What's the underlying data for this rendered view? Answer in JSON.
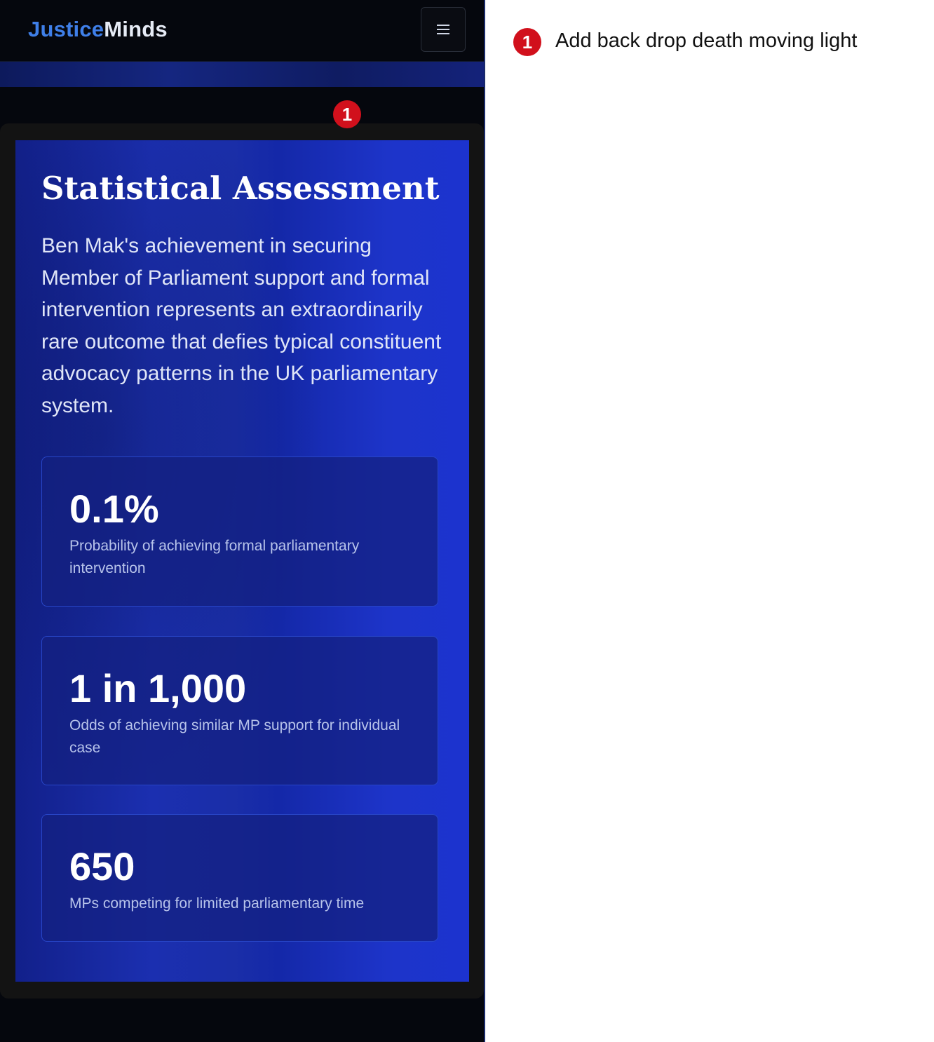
{
  "app": {
    "logo_part1": "Justice",
    "logo_part2": "Minds",
    "menu_icon": "hamburger-menu-icon"
  },
  "section": {
    "title": "Statistical Assessment",
    "intro": "Ben Mak's achievement in securing Member of Parliament support and formal intervention represents an extraordinarily rare outcome that defies typical constituent advocacy patterns in the UK parliamentary system."
  },
  "stats": [
    {
      "value": "0.1%",
      "label": "Probability of achieving formal parliamentary intervention"
    },
    {
      "value": "1 in 1,000",
      "label": "Odds of achieving similar MP support for individual case"
    },
    {
      "value": "650",
      "label": "MPs competing for limited parliamentary time"
    }
  ],
  "annotation": {
    "number": "1",
    "text": "Add back drop death moving light"
  },
  "colors": {
    "logo_accent": "#3f7fe8",
    "card_gradient_start": "#12208a",
    "card_gradient_end": "#1c33cf",
    "badge_red": "#d1101c"
  }
}
